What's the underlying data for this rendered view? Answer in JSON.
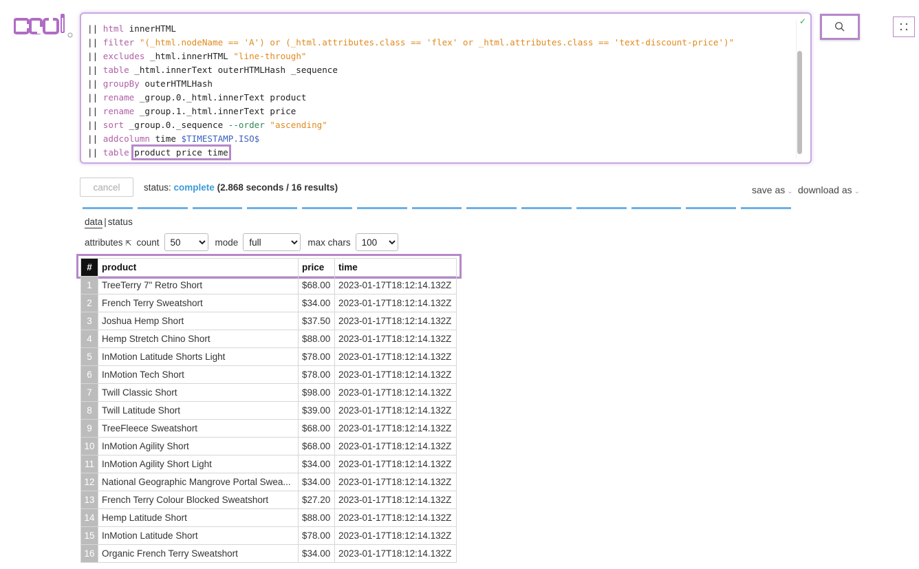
{
  "brand": {
    "logo_text": "crul"
  },
  "editor": {
    "lines": [
      [
        {
          "t": "|| "
        },
        {
          "t": "html",
          "c": "kw"
        },
        {
          "t": " innerHTML"
        }
      ],
      [
        {
          "t": "|| "
        },
        {
          "t": "filter",
          "c": "kw"
        },
        {
          "t": " \"(_html.nodeName == 'A') or (_html.attributes.class == 'flex' or _html.attributes.class == 'text-discount-price')\"",
          "c": "str"
        }
      ],
      [
        {
          "t": "|| "
        },
        {
          "t": "excludes",
          "c": "kw"
        },
        {
          "t": " _html.innerHTML "
        },
        {
          "t": "\"line-through\"",
          "c": "str"
        }
      ],
      [
        {
          "t": "|| "
        },
        {
          "t": "table",
          "c": "kw"
        },
        {
          "t": " _html.innerText outerHTMLHash _sequence"
        }
      ],
      [
        {
          "t": "|| "
        },
        {
          "t": "groupBy",
          "c": "kw"
        },
        {
          "t": " outerHTMLHash"
        }
      ],
      [
        {
          "t": "|| "
        },
        {
          "t": "rename",
          "c": "kw"
        },
        {
          "t": " _group.0._html.innerText product"
        }
      ],
      [
        {
          "t": "|| "
        },
        {
          "t": "rename",
          "c": "kw"
        },
        {
          "t": " _group.1._html.innerText price"
        }
      ],
      [
        {
          "t": "|| "
        },
        {
          "t": "sort",
          "c": "kw"
        },
        {
          "t": " _group.0._sequence "
        },
        {
          "t": "--order",
          "c": "flag"
        },
        {
          "t": " "
        },
        {
          "t": "\"ascending\"",
          "c": "str"
        }
      ],
      [
        {
          "t": "|| "
        },
        {
          "t": "addcolumn",
          "c": "kw"
        },
        {
          "t": " time "
        },
        {
          "t": "$TIMESTAMP.ISO$",
          "c": "var"
        }
      ],
      [
        {
          "t": "|| "
        },
        {
          "t": "table",
          "c": "kw"
        },
        {
          "t": " "
        },
        {
          "t": "product price time",
          "c": "hl"
        }
      ]
    ],
    "valid_mark": "✓"
  },
  "icons": {
    "search": "search-icon",
    "grid": "grid-icon"
  },
  "toolbar": {
    "cancel_label": "cancel",
    "status_prefix": "status:",
    "status_value": "complete",
    "status_meta": "(2.868 seconds / 16 results)",
    "save_as": "save as",
    "download_as": "download as",
    "caret": "⌄"
  },
  "progress": {
    "segments": 13,
    "color": "#6cb0e6"
  },
  "tabs": {
    "data": "data",
    "sep": "|",
    "status": "status"
  },
  "controls": {
    "attributes_label": "attributes",
    "attributes_icon": "⇱",
    "count_label": "count",
    "count_value": "50",
    "mode_label": "mode",
    "mode_value": "full",
    "maxchars_label": "max chars",
    "maxchars_value": "100"
  },
  "colors": {
    "accent": "#b587c9",
    "status": "#3b9ad9",
    "keyword": "#b05fa6",
    "string": "#e08a1e"
  },
  "table": {
    "headers": {
      "num": "#",
      "product": "product",
      "price": "price",
      "time": "time"
    },
    "rows": [
      {
        "n": "1",
        "product": "TreeTerry 7\" Retro Short",
        "price": "$68.00",
        "time": "2023-01-17T18:12:14.132Z"
      },
      {
        "n": "2",
        "product": "French Terry Sweatshort",
        "price": "$34.00",
        "time": "2023-01-17T18:12:14.132Z"
      },
      {
        "n": "3",
        "product": "Joshua Hemp Short",
        "price": "$37.50",
        "time": "2023-01-17T18:12:14.132Z"
      },
      {
        "n": "4",
        "product": "Hemp Stretch Chino Short",
        "price": "$88.00",
        "time": "2023-01-17T18:12:14.132Z"
      },
      {
        "n": "5",
        "product": "InMotion Latitude Shorts Light",
        "price": "$78.00",
        "time": "2023-01-17T18:12:14.132Z"
      },
      {
        "n": "6",
        "product": "InMotion Tech Short",
        "price": "$78.00",
        "time": "2023-01-17T18:12:14.132Z"
      },
      {
        "n": "7",
        "product": "Twill Classic Short",
        "price": "$98.00",
        "time": "2023-01-17T18:12:14.132Z"
      },
      {
        "n": "8",
        "product": "Twill Latitude Short",
        "price": "$39.00",
        "time": "2023-01-17T18:12:14.132Z"
      },
      {
        "n": "9",
        "product": "TreeFleece Sweatshort",
        "price": "$68.00",
        "time": "2023-01-17T18:12:14.132Z"
      },
      {
        "n": "10",
        "product": "InMotion Agility Short",
        "price": "$68.00",
        "time": "2023-01-17T18:12:14.132Z"
      },
      {
        "n": "11",
        "product": "InMotion Agility Short Light",
        "price": "$34.00",
        "time": "2023-01-17T18:12:14.132Z"
      },
      {
        "n": "12",
        "product": "National Geographic Mangrove Portal Swea...",
        "price": "$34.00",
        "time": "2023-01-17T18:12:14.132Z"
      },
      {
        "n": "13",
        "product": "French Terry Colour Blocked Sweatshort",
        "price": "$27.20",
        "time": "2023-01-17T18:12:14.132Z"
      },
      {
        "n": "14",
        "product": "Hemp Latitude Short",
        "price": "$88.00",
        "time": "2023-01-17T18:12:14.132Z"
      },
      {
        "n": "15",
        "product": "InMotion Latitude Short",
        "price": "$78.00",
        "time": "2023-01-17T18:12:14.132Z"
      },
      {
        "n": "16",
        "product": "Organic French Terry Sweatshort",
        "price": "$34.00",
        "time": "2023-01-17T18:12:14.132Z"
      }
    ]
  }
}
